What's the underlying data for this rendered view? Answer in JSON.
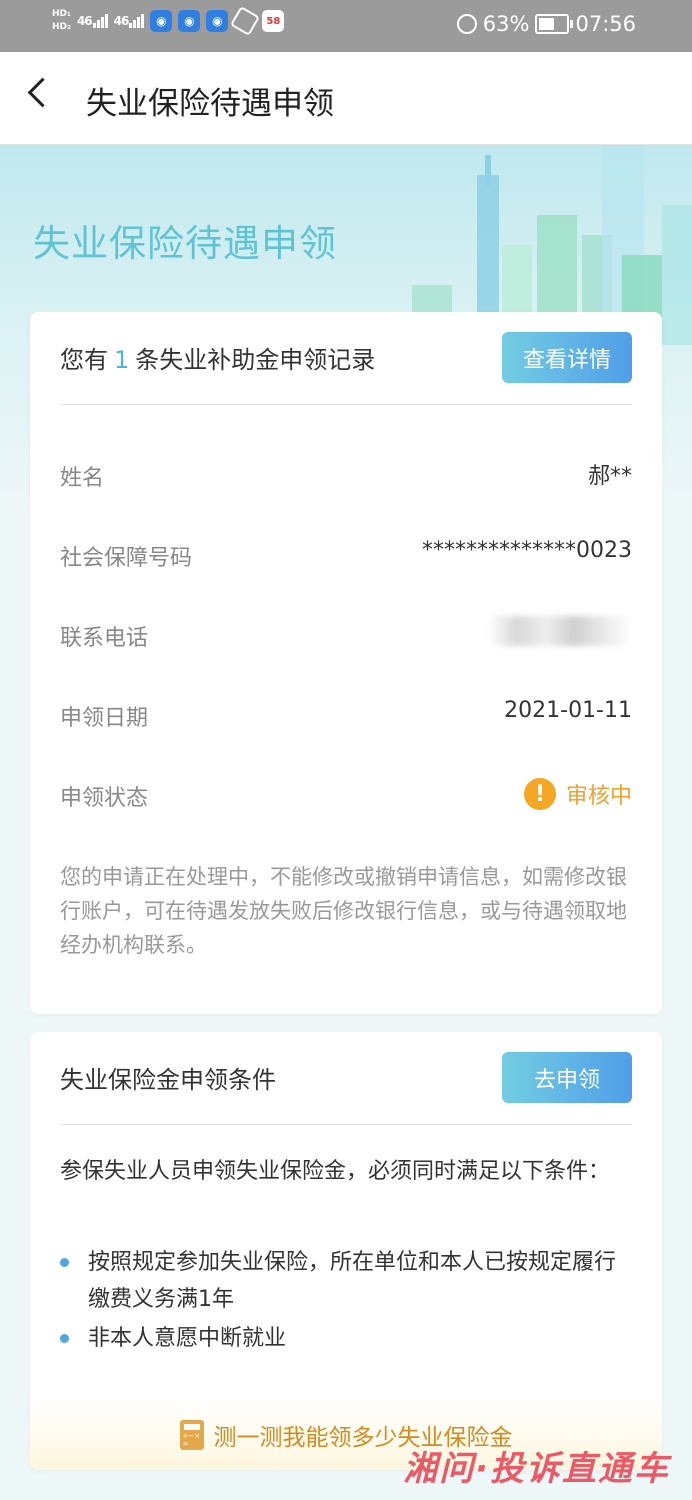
{
  "status_bar": {
    "network": "46",
    "battery": "63%",
    "time": "07:56",
    "app_badge": "58"
  },
  "nav": {
    "title": "失业保险待遇申领"
  },
  "hero": {
    "title": "失业保险待遇申领"
  },
  "record_card": {
    "head_prefix": "您有",
    "count": "1",
    "head_suffix": "条失业补助金申领记录",
    "detail_button": "查看详情",
    "rows": [
      {
        "label": "姓名",
        "value": "郝**"
      },
      {
        "label": "社会保障号码",
        "value": "**************0023"
      },
      {
        "label": "联系电话",
        "value": ""
      },
      {
        "label": "申领日期",
        "value": "2021-01-11"
      },
      {
        "label": "申领状态",
        "value": "审核中"
      }
    ],
    "notice": "您的申请正在处理中，不能修改或撤销申请信息，如需修改银行账户，可在待遇发放失败后修改银行信息，或与待遇领取地经办机构联系。"
  },
  "condition_card": {
    "title": "失业保险金申领条件",
    "apply_button": "去申领",
    "intro": "参保失业人员申领失业保险金，必须同时满足以下条件：",
    "conditions": [
      "按照规定参加失业保险，所在单位和本人已按规定履行缴费义务满1年",
      "非本人意愿中断就业"
    ],
    "calculator_link": "测一测我能领多少失业保险金"
  },
  "watermark": "湘问·投诉直通车",
  "colors": {
    "accent": "#4fb3d6",
    "button_start": "#73cde2",
    "button_end": "#4f9ee8",
    "warning": "#f2a12a",
    "status_bar": "#9b9b9b"
  }
}
